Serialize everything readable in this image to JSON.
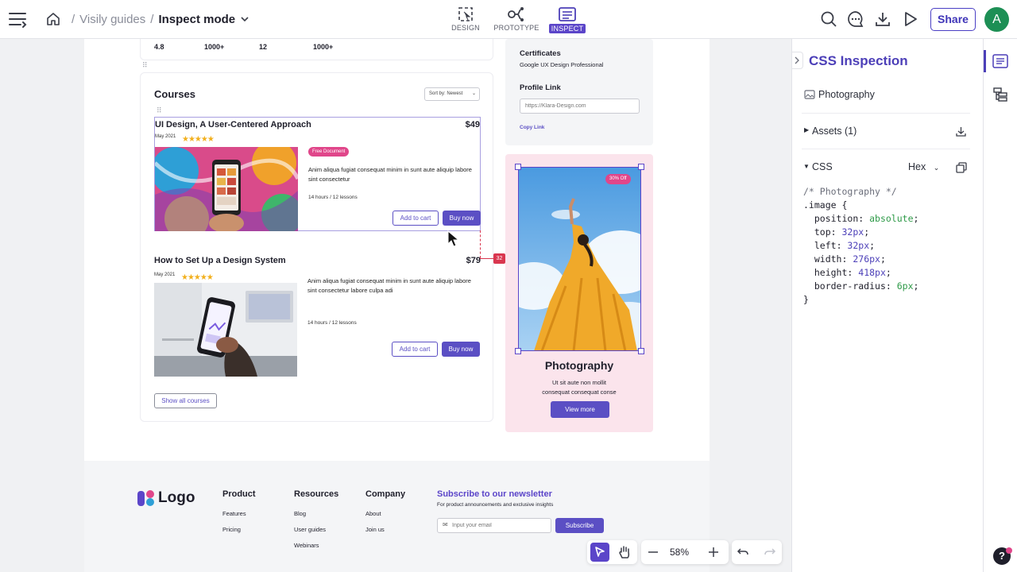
{
  "topbar": {
    "breadcrumb": {
      "parent": "Visily guides",
      "separator": "/",
      "current": "Inspect mode"
    },
    "modes": [
      {
        "label": "DESIGN",
        "active": false
      },
      {
        "label": "PROTOTYPE",
        "active": false
      },
      {
        "label": "INSPECT",
        "active": true
      }
    ],
    "share_label": "Share",
    "avatar_initial": "A"
  },
  "canvas": {
    "stats": [
      "4.8",
      "1000+",
      "12",
      "1000+"
    ],
    "courses": {
      "heading": "Courses",
      "sort_label": "Sort by: Newest",
      "items": [
        {
          "title": "UI Design, A User-Centered Approach",
          "price": "$49",
          "date": "May 2021",
          "badge": "Free Document",
          "description": "Anim aliqua fugiat consequat minim in sunt aute aliquip labore sint consectetur",
          "meta": "14 hours / 12 lessons",
          "add_label": "Add to cart",
          "buy_label": "Buy now"
        },
        {
          "title": "How to Set Up a Design System",
          "price": "$79",
          "date": "May 2021",
          "description": "Anim aliqua fugiat consequat minim in sunt aute aliquip labore sint consectetur labore culpa adi",
          "meta": "14 hours / 12 lessons",
          "add_label": "Add to cart",
          "buy_label": "Buy now"
        }
      ],
      "show_all_label": "Show all courses"
    },
    "profile": {
      "certificates_heading": "Certificates",
      "certificates_value": "Google UX Design Professional",
      "profile_link_heading": "Profile Link",
      "profile_link_placeholder": "https://Klara-Design.com",
      "copy_link_label": "Copy Link"
    },
    "photo_card": {
      "discount_badge": "30% Off",
      "title": "Photography",
      "description_line1": "Ut sit aute non mollit",
      "description_line2": "consequat consequat conse",
      "button_label": "View more"
    },
    "measure_label": "32",
    "footer": {
      "logo_text": "Logo",
      "columns": [
        {
          "heading": "Product",
          "links": [
            "Features",
            "Pricing"
          ]
        },
        {
          "heading": "Resources",
          "links": [
            "Blog",
            "User guides",
            "Webinars"
          ]
        },
        {
          "heading": "Company",
          "links": [
            "About",
            "Join us"
          ]
        }
      ],
      "newsletter_heading": "Subscribe to our newsletter",
      "newsletter_sub": "For product announcements and exclusive insights",
      "email_placeholder": "Input your email",
      "subscribe_label": "Subscribe"
    }
  },
  "inspect_panel": {
    "title": "CSS Inspection",
    "layer_name": "Photography",
    "assets_label": "Assets (1)",
    "css_label": "CSS",
    "format_value": "Hex",
    "code": {
      "comment": "/* Photography */",
      "selector": ".image {",
      "props": [
        {
          "name": "position",
          "value": "absolute"
        },
        {
          "name": "top",
          "value": "32px"
        },
        {
          "name": "left",
          "value": "32px"
        },
        {
          "name": "width",
          "value": "276px"
        },
        {
          "name": "height",
          "value": "418px"
        },
        {
          "name": "border-radius",
          "value": "6px"
        }
      ],
      "close": "}"
    }
  },
  "bottom_bar": {
    "zoom": "58%"
  },
  "colors": {
    "accent": "#5b45c9",
    "selection": "#7a6cd6",
    "badge_pink": "#e0468a",
    "measure_red": "#d9364f",
    "avatar_green": "#1d8f55"
  }
}
